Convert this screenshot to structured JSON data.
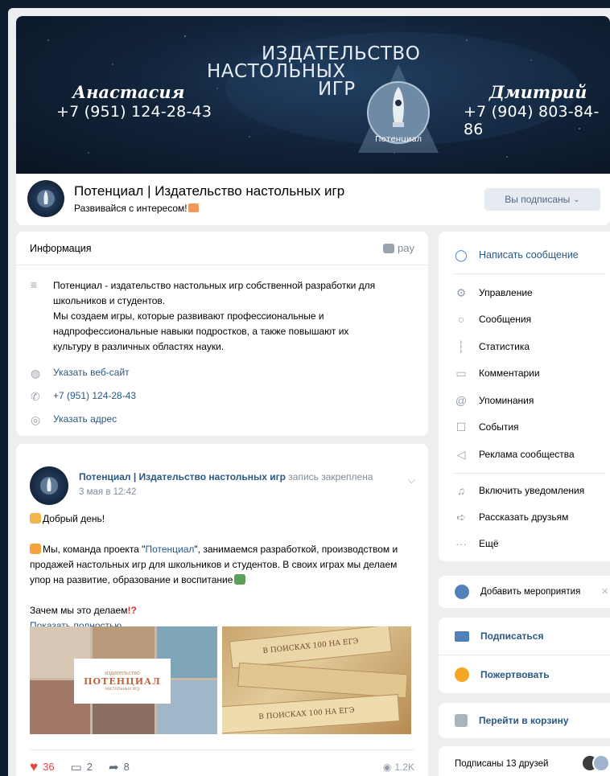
{
  "cover": {
    "left_name": "Анастасия",
    "left_phone": "+7 (951) 124-28-43",
    "title_line1": "ИЗДАТЕЛЬСТВО",
    "title_line2": "НАСТОЛЬНЫХ",
    "title_line3": "ИГР",
    "logo_text": "Потенциал",
    "right_name": "Дмитрий",
    "right_phone": "+7 (904) 803-84-86"
  },
  "group": {
    "name": "Потенциал | Издательство настольных игр",
    "status": "Развивайся с интересом!",
    "subscribed_button": "Вы подписаны",
    "chevron": "⌄"
  },
  "info": {
    "title": "Информация",
    "pay_label": "pay",
    "description_lines": [
      "Потенциал - издательство настольных игр собственной разработки для",
      "школьников и студентов.",
      "Мы создаем игры, которые развивают профессиональные и",
      "надпрофессиональные навыки подростков, а также повышают их",
      "культуру в различных областях науки."
    ],
    "website_link": "Указать веб-сайт",
    "phone": "+7 (951) 124-28-43",
    "address_link": "Указать адрес"
  },
  "post": {
    "author": "Потенциал | Издательство настольных игр",
    "pinned": "запись закреплена",
    "date": "3 мая в 12:42",
    "greeting": "Добрый день!",
    "para1_a": "Мы, команда проекта \"",
    "para1_link": "Потенциал",
    "para1_b": "\", занимаемся разработкой, производством и",
    "para1_line2": "продажей настольных игр для школьников и студентов. В своих играх мы делаем",
    "para1_line3": "упор на развитие, образование и воспитание",
    "question": "Зачем мы это делаем",
    "show_more": "Показать полностью…",
    "photo_brand_small": "издательство",
    "photo_brand": "ПОТЕНЦИАЛ",
    "photo_brand_sub": "настольных игр",
    "box_text": "В ПОИСКАХ 100 НА ЕГЭ",
    "likes": "36",
    "comments": "2",
    "shares": "8",
    "views": "1.2K"
  },
  "menu": {
    "write_message": "Написать сообщение",
    "items": [
      "Управление",
      "Сообщения",
      "Статистика",
      "Комментарии",
      "Упоминания",
      "События",
      "Реклама сообщества"
    ],
    "notify": "Включить уведомления",
    "tell_friends": "Рассказать друзьям",
    "more": "Ещё"
  },
  "event": {
    "label": "Добавить мероприятия",
    "close": "×"
  },
  "actions": {
    "subscribe": "Подписаться",
    "donate": "Пожертвовать"
  },
  "cart": {
    "label": "Перейти в корзину"
  },
  "friends": {
    "label": "Подписаны 13 друзей"
  },
  "colors": {
    "accent": "#2a5885",
    "like": "#e64646",
    "page_bg": "#edeef0",
    "cover_bg": "#12243b"
  }
}
